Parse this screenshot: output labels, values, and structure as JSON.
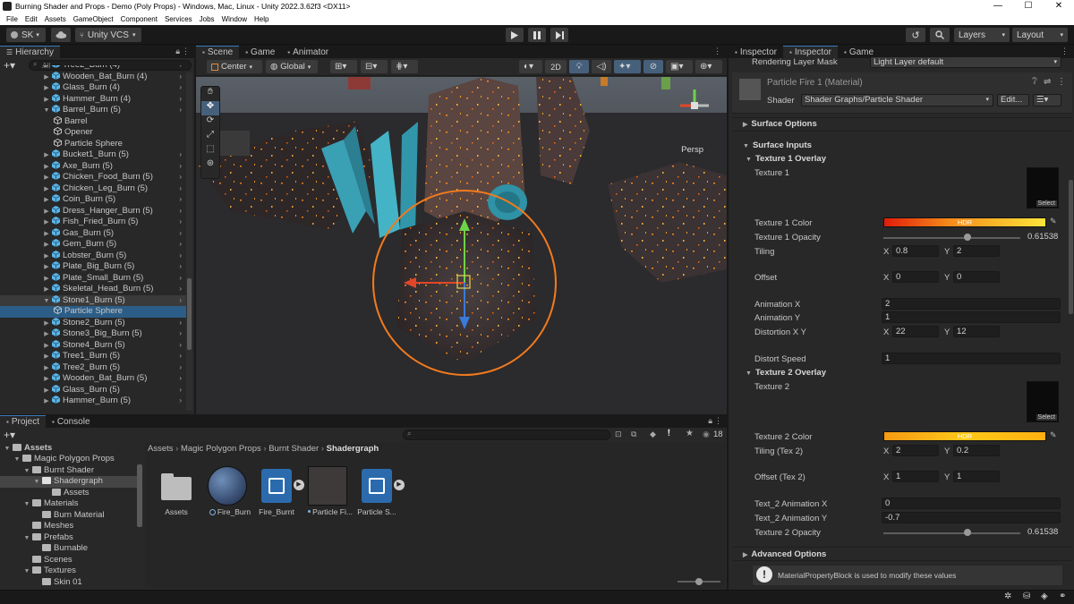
{
  "window": {
    "title": "Burning Shader and Props - Demo (Poly Props) - Windows, Mac, Linux - Unity 2022.3.62f3 <DX11>",
    "min": "—",
    "max": "☐",
    "close": "✕"
  },
  "menu": [
    "File",
    "Edit",
    "Assets",
    "GameObject",
    "Component",
    "Services",
    "Jobs",
    "Window",
    "Help"
  ],
  "toolbar": {
    "account": "SK",
    "vcs": "Unity VCS",
    "layers": "Layers",
    "layout": "Layout"
  },
  "hierarchy": {
    "tab": "Hierarchy",
    "search_placeholder": "All",
    "items": [
      {
        "label": "Tree2_Burn (4)",
        "indent": 0
      },
      {
        "label": "Wooden_Bat_Burn (4)",
        "indent": 0
      },
      {
        "label": "Glass_Burn (4)",
        "indent": 0
      },
      {
        "label": "Hammer_Burn (4)",
        "indent": 0
      },
      {
        "label": "Barrel_Burn (5)",
        "indent": 0,
        "open": true
      },
      {
        "label": "Barrel",
        "indent": 1
      },
      {
        "label": "Opener",
        "indent": 1
      },
      {
        "label": "Particle Sphere",
        "indent": 1
      },
      {
        "label": "Bucket1_Burn (5)",
        "indent": 0
      },
      {
        "label": "Axe_Burn (5)",
        "indent": 0
      },
      {
        "label": "Chicken_Food_Burn (5)",
        "indent": 0
      },
      {
        "label": "Chicken_Leg_Burn (5)",
        "indent": 0
      },
      {
        "label": "Coin_Burn (5)",
        "indent": 0
      },
      {
        "label": "Dress_Hanger_Burn (5)",
        "indent": 0
      },
      {
        "label": "Fish_Fried_Burn (5)",
        "indent": 0
      },
      {
        "label": "Gas_Burn (5)",
        "indent": 0
      },
      {
        "label": "Gem_Burn (5)",
        "indent": 0
      },
      {
        "label": "Lobster_Burn (5)",
        "indent": 0
      },
      {
        "label": "Plate_Big_Burn (5)",
        "indent": 0
      },
      {
        "label": "Plate_Small_Burn (5)",
        "indent": 0
      },
      {
        "label": "Skeletal_Head_Burn (5)",
        "indent": 0
      },
      {
        "label": "Stone1_Burn (5)",
        "indent": 0,
        "open": true,
        "hover": true
      },
      {
        "label": "Particle Sphere",
        "indent": 1,
        "selected": true
      },
      {
        "label": "Stone2_Burn (5)",
        "indent": 0
      },
      {
        "label": "Stone3_Big_Burn (5)",
        "indent": 0
      },
      {
        "label": "Stone4_Burn (5)",
        "indent": 0
      },
      {
        "label": "Tree1_Burn (5)",
        "indent": 0
      },
      {
        "label": "Tree2_Burn (5)",
        "indent": 0
      },
      {
        "label": "Wooden_Bat_Burn (5)",
        "indent": 0
      },
      {
        "label": "Glass_Burn (5)",
        "indent": 0
      },
      {
        "label": "Hammer_Burn (5)",
        "indent": 0
      }
    ]
  },
  "scene": {
    "tabs": [
      "Scene",
      "Game",
      "Animator"
    ],
    "pivot": "Center",
    "space": "Global",
    "mode_2d": "2D",
    "persp": "Persp"
  },
  "project": {
    "tabs": [
      "Project",
      "Console"
    ],
    "tree": [
      {
        "label": "Assets",
        "indent": 0,
        "bold": true
      },
      {
        "label": "Magic Polygon Props",
        "indent": 1
      },
      {
        "label": "Burnt Shader",
        "indent": 2
      },
      {
        "label": "Shadergraph",
        "indent": 3,
        "selected": true
      },
      {
        "label": "Assets",
        "indent": 4
      },
      {
        "label": "Materials",
        "indent": 2
      },
      {
        "label": "Burn Material",
        "indent": 3
      },
      {
        "label": "Meshes",
        "indent": 2
      },
      {
        "label": "Prefabs",
        "indent": 2
      },
      {
        "label": "Burnable",
        "indent": 3
      },
      {
        "label": "Scenes",
        "indent": 2
      },
      {
        "label": "Textures",
        "indent": 2
      },
      {
        "label": "Skin 01",
        "indent": 3
      }
    ],
    "breadcrumb": [
      "Assets",
      "Magic Polygon Props",
      "Burnt Shader",
      "Shadergraph"
    ],
    "count": "18",
    "assets": [
      "Assets",
      "Fire_Burn",
      "Fire_Burnt",
      "Particle Fi...",
      "Particle S..."
    ]
  },
  "inspector": {
    "tabs": [
      "Inspector",
      "Inspector",
      "Game"
    ],
    "rendering_layer_label": "Rendering Layer Mask",
    "rendering_layer_value": "Light Layer default",
    "material_name": "Particle Fire 1 (Material)",
    "shader_label": "Shader",
    "shader_value": "Shader Graphs/Particle Shader",
    "edit": "Edit...",
    "surface_options": "Surface Options",
    "surface_inputs": "Surface Inputs",
    "tex1_overlay": "Texture 1 Overlay",
    "tex1": "Texture 1",
    "tex1_color": "Texture 1 Color",
    "tex1_opacity": "Texture 1 Opacity",
    "tex1_opacity_value": "0.61538",
    "tex1_opacity_fraction": 0.615,
    "tiling": "Tiling",
    "tiling_x": "0.8",
    "tiling_y": "2",
    "offset": "Offset",
    "offset_x": "0",
    "offset_y": "0",
    "anim_x": "Animation X",
    "anim_x_value": "2",
    "anim_y": "Animation Y",
    "anim_y_value": "1",
    "distortion": "Distortion X Y",
    "distortion_x": "22",
    "distortion_y": "12",
    "distort_speed": "Distort Speed",
    "distort_speed_value": "1",
    "tex2_overlay": "Texture 2 Overlay",
    "tex2": "Texture 2",
    "tex2_color": "Texture 2 Color",
    "tiling2": "Tiling (Tex 2)",
    "tiling2_x": "2",
    "tiling2_y": "0.2",
    "offset2": "Offset (Tex 2)",
    "offset2_x": "1",
    "offset2_y": "1",
    "t2_anim_x": "Text_2 Animation X",
    "t2_anim_x_value": "0",
    "t2_anim_y": "Text_2 Animation Y",
    "t2_anim_y_value": "-0.7",
    "tex2_opacity": "Texture 2 Opacity",
    "tex2_opacity_value": "0.61538",
    "tex2_opacity_fraction": 0.615,
    "advanced": "Advanced Options",
    "info": "MaterialPropertyBlock is used to modify these values",
    "select": "Select",
    "hdr": "HDR",
    "x": "X",
    "y": "Y"
  }
}
